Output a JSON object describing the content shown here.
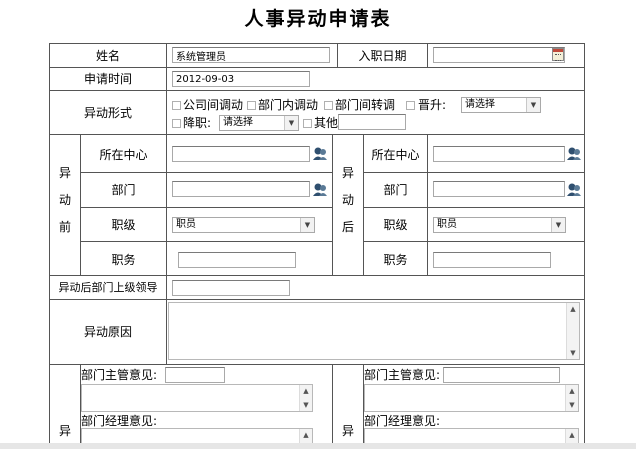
{
  "form": {
    "title": "人事异动申请表",
    "name": {
      "label": "姓名",
      "value": "系统管理员"
    },
    "entry_date": {
      "label": "入职日期",
      "value": ""
    },
    "apply_time": {
      "label": "申请时间",
      "value": "2012-09-03"
    },
    "change_type": {
      "label": "异动形式",
      "options": [
        "公司间调动",
        "部门内调动",
        "部门间转调",
        "晋升:",
        "降职:",
        "其他"
      ],
      "promotion_select": "请选择",
      "demotion_select": "请选择",
      "other_value": ""
    },
    "before": {
      "label_chars": [
        "异",
        "动",
        "前"
      ],
      "center": {
        "label": "所在中心",
        "value": ""
      },
      "dept": {
        "label": "部门",
        "value": ""
      },
      "level": {
        "label": "职级",
        "value": "职员"
      },
      "position": {
        "label": "职务",
        "value": ""
      }
    },
    "after": {
      "label_chars": [
        "异",
        "动",
        "后"
      ],
      "center": {
        "label": "所在中心",
        "value": ""
      },
      "dept": {
        "label": "部门",
        "value": ""
      },
      "level": {
        "label": "职级",
        "value": "职员"
      },
      "position": {
        "label": "职务",
        "value": ""
      }
    },
    "leader": {
      "label": "异动后部门上级领导",
      "value": ""
    },
    "reason": {
      "label": "异动原因",
      "value": ""
    },
    "opinions_left": {
      "label_char": "异",
      "manager_label": "部门主管意见:",
      "director_label": "部门经理意见:"
    },
    "opinions_right": {
      "label_char": "异",
      "manager_label": "部门主管意见:",
      "director_label": "部门经理意见:"
    }
  },
  "colors": {
    "border": "#555555",
    "input_border": "#a9a9a9",
    "calendar_red": "#c04a3a"
  }
}
